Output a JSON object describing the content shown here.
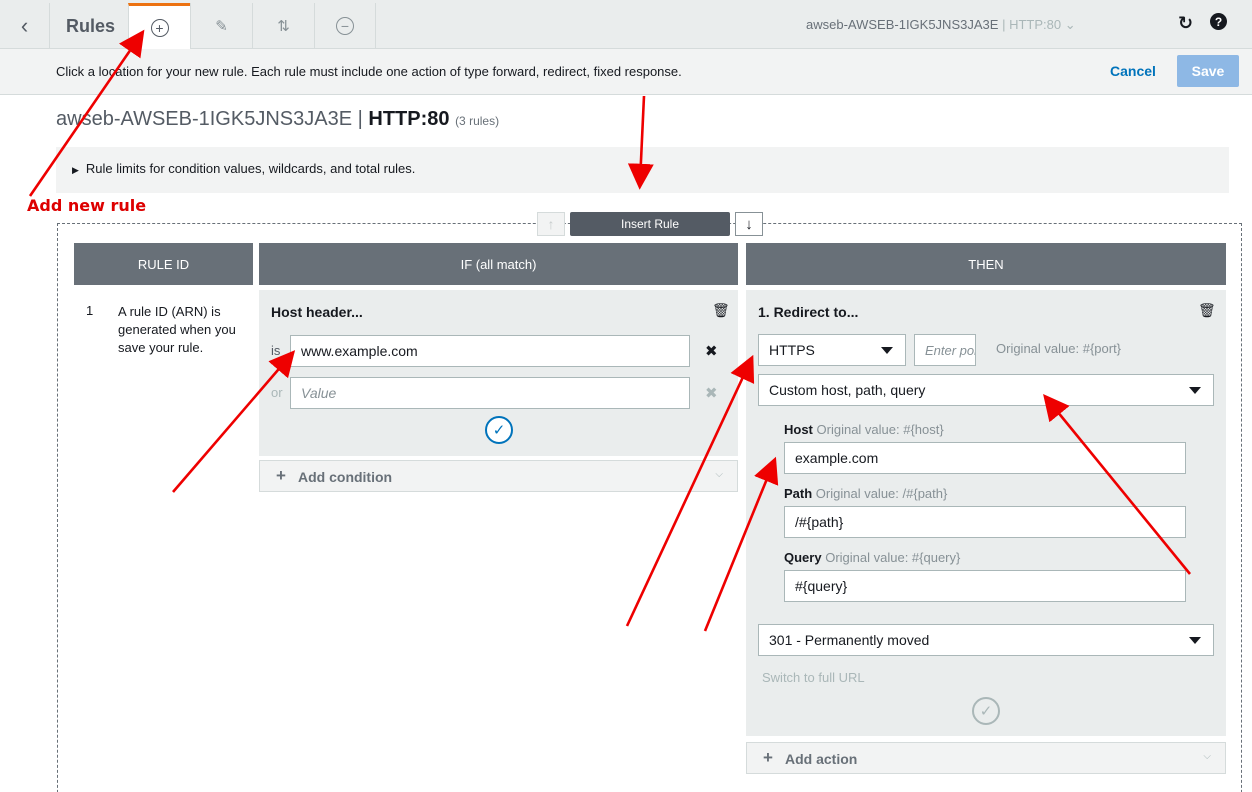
{
  "toolbar": {
    "title": "Rules",
    "back_icon": "chevron-left-icon",
    "selector": "awseb-AWSEB-1IGK5JNS3JA3E",
    "selector_port": "HTTP:80",
    "buttons": [
      "add-rule-icon",
      "edit-icon",
      "reorder-icon",
      "delete-rule-icon"
    ]
  },
  "infobar": {
    "message": "Click a location for your new rule. Each rule must include one action of type forward, redirect, fixed response.",
    "cancel": "Cancel",
    "save": "Save"
  },
  "listener": {
    "name": "awseb-AWSEB-1IGK5JNS3JA3E",
    "separator": "|",
    "port": "HTTP:80",
    "count": "(3 rules)"
  },
  "limits": {
    "text": "Rule limits for condition values, wildcards, and total rules."
  },
  "annotation": {
    "text": "Add  new rule",
    "color": "#dd0000"
  },
  "insert": {
    "label": "Insert Rule"
  },
  "columns": {
    "rule_id": "RULE ID",
    "if": "IF (all match)",
    "then": "THEN"
  },
  "rule": {
    "number": "1",
    "description": "A rule ID (ARN) is generated when you save your rule."
  },
  "condition": {
    "title": "Host header...",
    "is_label": "is",
    "or_label": "or",
    "value": "www.example.com",
    "placeholder": "Value",
    "add_condition": "Add condition"
  },
  "action": {
    "title": "1. Redirect to...",
    "protocol": "HTTPS",
    "port_placeholder": "Enter port",
    "port_hint": "Original value: #{port}",
    "mode": "Custom host, path, query",
    "host_label": "Host",
    "host_hint": "Original value: #{host}",
    "host_value": "example.com",
    "path_label": "Path",
    "path_hint": "Original value: /#{path}",
    "path_value": "/#{path}",
    "query_label": "Query",
    "query_hint": "Original value: #{query}",
    "query_value": "#{query}",
    "status": "301 - Permanently moved",
    "switch_url": "Switch to full URL",
    "add_action": "Add action"
  },
  "colors": {
    "accent_orange": "#ec7211",
    "link_blue": "#0073bb",
    "save_disabled": "#8eb8e5",
    "header_gray": "#687078",
    "arrow_red": "#ee0000"
  }
}
